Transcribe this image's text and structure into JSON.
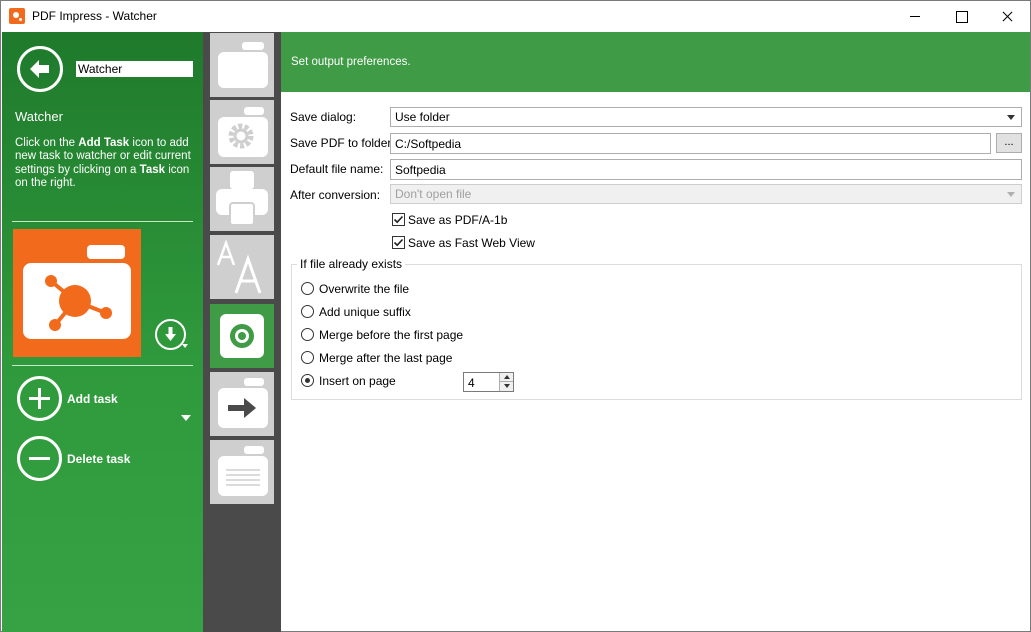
{
  "window": {
    "title": "PDF Impress - Watcher"
  },
  "left_panel": {
    "watcher_name_value": "Watcher",
    "heading": "Watcher",
    "description": {
      "p1": "Click on the ",
      "b1": "Add Task",
      "p2": " icon to add new task to watcher or edit current settings by clicking on a ",
      "b2": "Task",
      "p3": " icon on the right."
    },
    "add_task_label": "Add task",
    "delete_task_label": "Delete task"
  },
  "icon_strip": {
    "items": [
      {
        "icon": "folder-icon",
        "active": false
      },
      {
        "icon": "settings-icon",
        "active": false
      },
      {
        "icon": "printer-icon",
        "active": false
      },
      {
        "icon": "font-icon",
        "active": false
      },
      {
        "icon": "disc-icon",
        "active": true
      },
      {
        "icon": "export-icon",
        "active": false
      },
      {
        "icon": "document-list-icon",
        "active": false
      }
    ]
  },
  "header": {
    "text": "Set output preferences."
  },
  "form": {
    "save_dialog_label": "Save dialog:",
    "save_dialog_value": "Use folder",
    "save_folder_label": "Save PDF to folder:",
    "save_folder_value": "C:/Softpedia",
    "browse_label": "...",
    "default_name_label": "Default file name:",
    "default_name_value": "Softpedia",
    "after_conversion_label": "After conversion:",
    "after_conversion_value": "Don't open file",
    "pdfa_label": "Save as PDF/A-1b",
    "fastweb_label": "Save as Fast Web View"
  },
  "file_exists": {
    "title": "If file already exists",
    "options": [
      "Overwrite the file",
      "Add unique suffix",
      "Merge before the first page",
      "Merge after the last page",
      "Insert on page"
    ],
    "selected": "Insert on page",
    "page_value": "4"
  },
  "colors": {
    "accent_green": "#3f9b45",
    "task_orange": "#f26a1b",
    "strip_dark": "#4a4a4a"
  }
}
